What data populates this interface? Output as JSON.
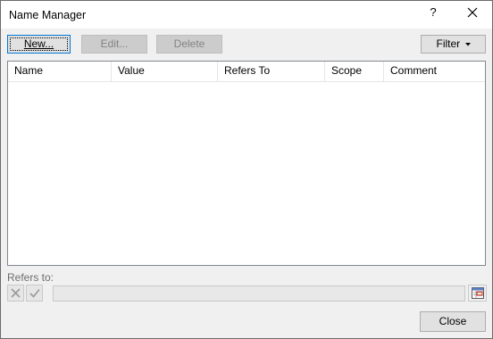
{
  "window": {
    "title": "Name Manager",
    "help_label": "?"
  },
  "toolbar": {
    "new_label": "New...",
    "edit_label": "Edit...",
    "delete_label": "Delete",
    "filter_label": "Filter"
  },
  "table": {
    "columns": [
      "Name",
      "Value",
      "Refers To",
      "Scope",
      "Comment"
    ],
    "rows": []
  },
  "refers_to": {
    "label": "Refers to:",
    "value": ""
  },
  "footer": {
    "close_label": "Close"
  },
  "icons": {
    "close": "close-icon",
    "cancel": "cancel-x-icon",
    "confirm": "checkmark-icon",
    "collapse": "collapse-dialog-icon",
    "filter_dropdown": "dropdown-arrow-icon"
  },
  "colors": {
    "focus_border": "#0078d7",
    "window_bg": "#f0f0f0",
    "list_bg": "#ffffff"
  }
}
